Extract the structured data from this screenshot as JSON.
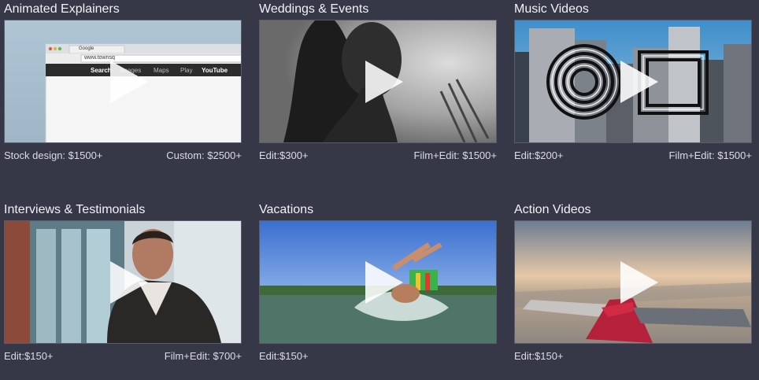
{
  "tiles": [
    {
      "title": "Animated Explainers",
      "price_left": "Stock design: $1500+",
      "price_right": "Custom: $2500+",
      "browser": {
        "tab": "Google",
        "url": "www.townsq",
        "links": [
          "Search",
          "Images",
          "Maps",
          "Play",
          "YouTube"
        ]
      }
    },
    {
      "title": "Weddings & Events",
      "price_left": "Edit:$300+",
      "price_right": "Film+Edit: $1500+"
    },
    {
      "title": "Music Videos",
      "price_left": "Edit:$200+",
      "price_right": "Film+Edit: $1500+"
    },
    {
      "title": "Interviews & Testimonials",
      "price_left": "Edit:$150+",
      "price_right": "Film+Edit: $700+"
    },
    {
      "title": "Vacations",
      "price_left": "Edit:$150+",
      "price_right": ""
    },
    {
      "title": "Action Videos",
      "price_left": "Edit:$150+",
      "price_right": ""
    }
  ],
  "icons": {
    "play": "play-icon"
  },
  "colors": {
    "background": "#363747",
    "text": "#f2f2f6"
  }
}
